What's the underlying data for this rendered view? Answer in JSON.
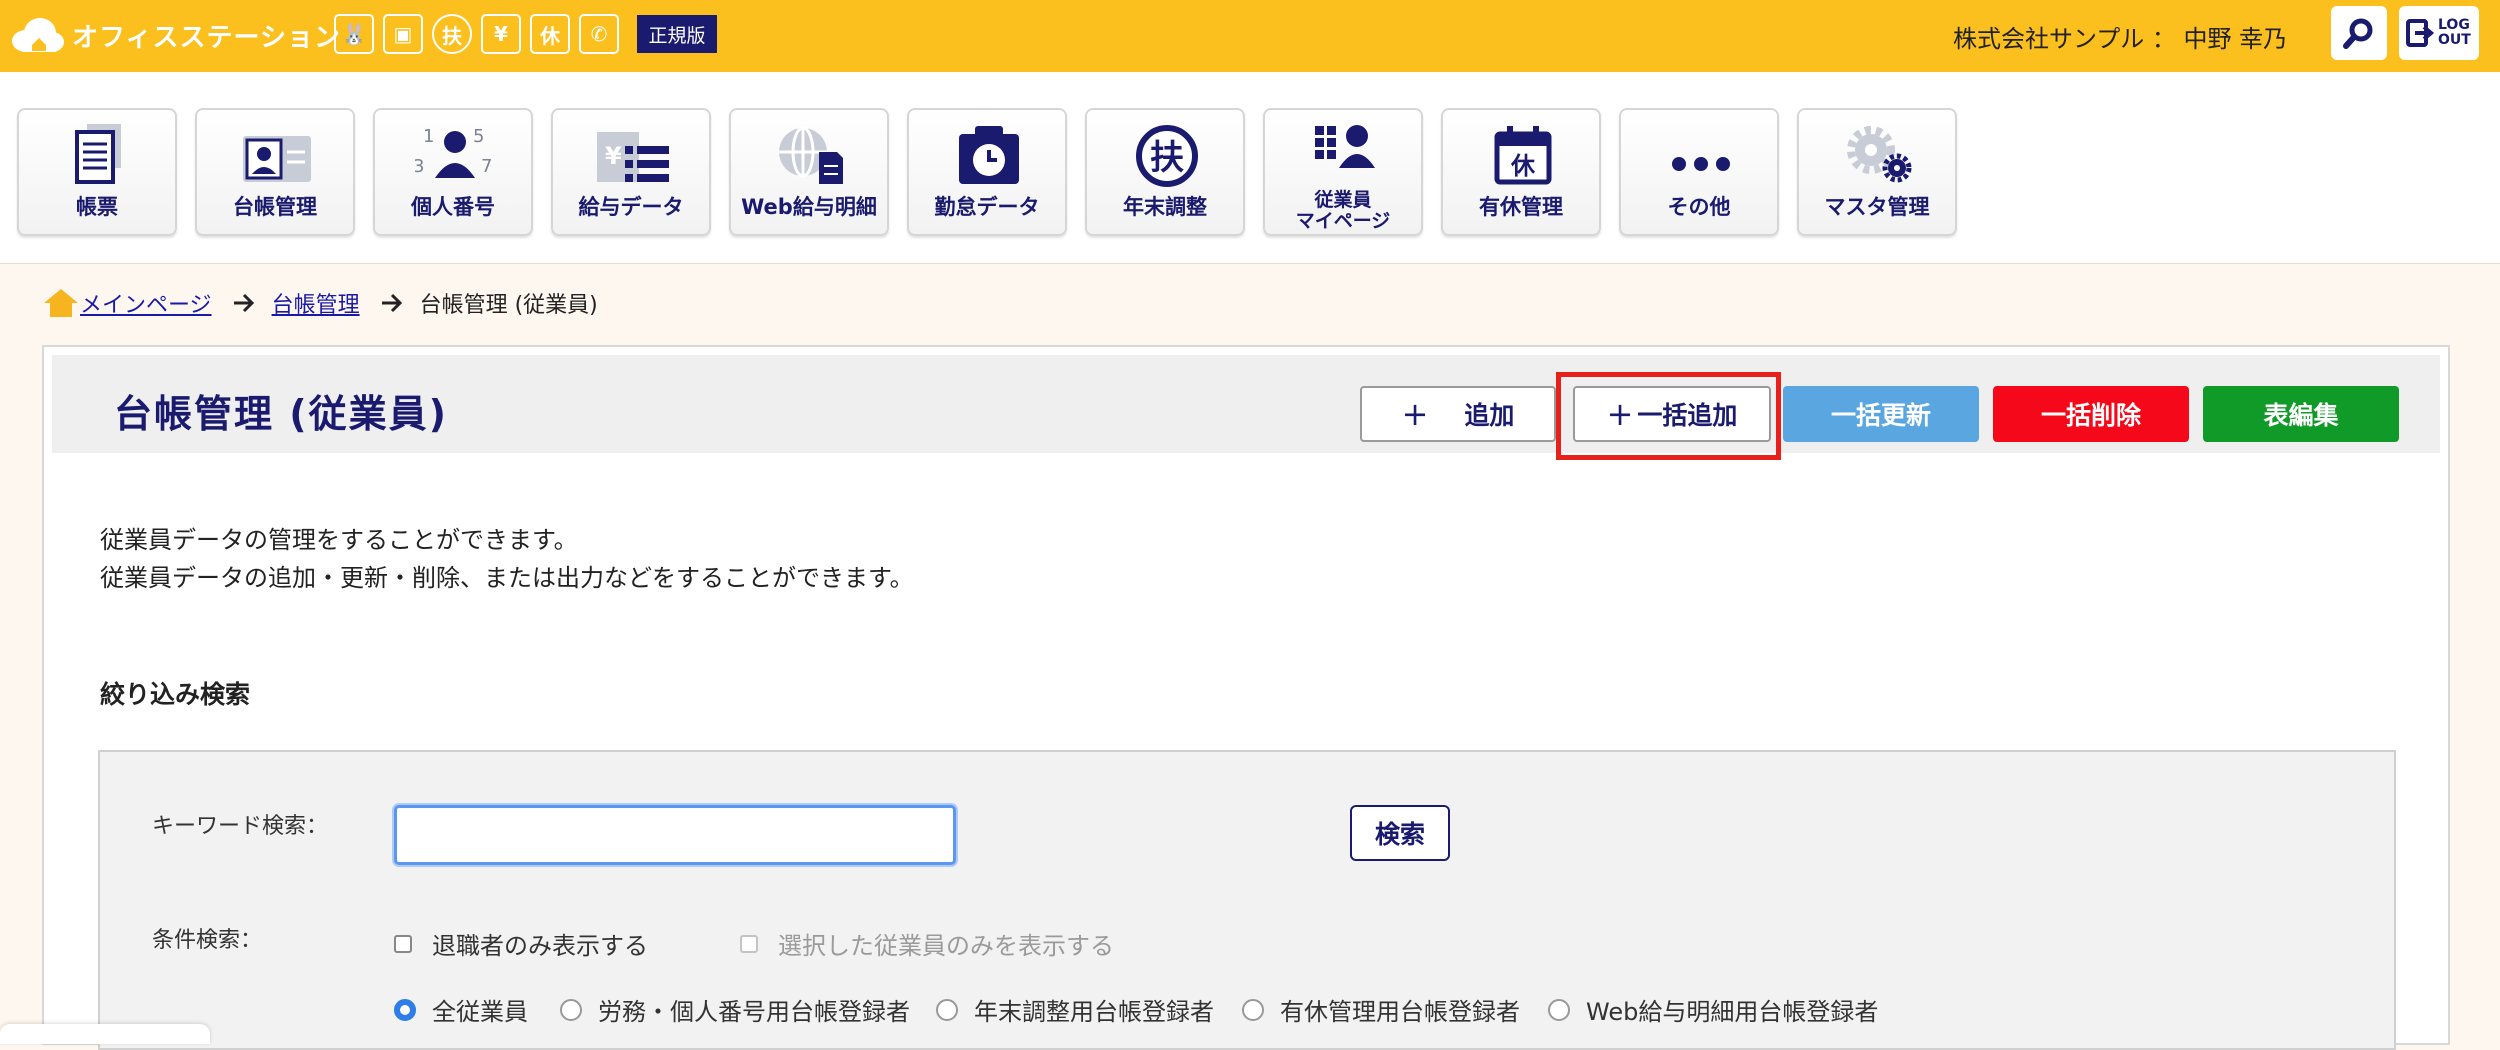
{
  "header": {
    "brand": "オフィスステーション",
    "edition": "正規版",
    "company_user": "株式会社サンプル ： 中野 幸乃",
    "logout_label": "LOG OUT",
    "mini_icons": [
      {
        "name": "rabbit-icon",
        "glyph": "🐰"
      },
      {
        "name": "briefcase-icon",
        "glyph": "▣"
      },
      {
        "name": "fu-icon",
        "glyph": "扶"
      },
      {
        "name": "payroll-icon",
        "glyph": "¥"
      },
      {
        "name": "kyu-icon",
        "glyph": "休"
      },
      {
        "name": "phone-icon",
        "glyph": "✆"
      }
    ],
    "colors": {
      "bar": "#fbbf1e",
      "navy": "#1a1a6e"
    }
  },
  "nav": {
    "tiles": [
      {
        "name": "nav-tile-forms",
        "label": "帳票",
        "icon": "document-icon"
      },
      {
        "name": "nav-tile-ledger",
        "label": "台帳管理",
        "icon": "id-card-icon"
      },
      {
        "name": "nav-tile-my-number",
        "label": "個人番号",
        "icon": "person-numbers-icon"
      },
      {
        "name": "nav-tile-payroll-data",
        "label": "給与データ",
        "icon": "payroll-icon"
      },
      {
        "name": "nav-tile-web-payslip",
        "label": "Web給与明細",
        "icon": "globe-doc-icon"
      },
      {
        "name": "nav-tile-attendance",
        "label": "勤怠データ",
        "icon": "clock-board-icon"
      },
      {
        "name": "nav-tile-year-end",
        "label": "年末調整",
        "icon": "fu-circle-icon"
      },
      {
        "name": "nav-tile-employee-mypage",
        "label": "従業員\nマイページ",
        "icon": "employee-grid-icon"
      },
      {
        "name": "nav-tile-paid-leave",
        "label": "有休管理",
        "icon": "calendar-kyu-icon"
      },
      {
        "name": "nav-tile-others",
        "label": "その他",
        "icon": "dots-icon"
      },
      {
        "name": "nav-tile-master",
        "label": "マスタ管理",
        "icon": "gears-icon"
      }
    ]
  },
  "breadcrumb": {
    "home": "メインページ",
    "ledger": "台帳管理",
    "current": "台帳管理 (従業員)"
  },
  "page": {
    "title": "台帳管理 (従業員)",
    "buttons": {
      "add": "追加",
      "bulk_add": "一括追加",
      "bulk_update": "一括更新",
      "bulk_delete": "一括削除",
      "table_edit": "表編集"
    },
    "description": [
      "従業員データの管理をすることができます。",
      "従業員データの追加・更新・削除、または出力などをすることができます。"
    ],
    "filter_title": "絞り込み検索"
  },
  "search": {
    "keyword_label": "キーワード検索：",
    "keyword_value": "",
    "search_button": "検索",
    "condition_label": "条件検索：",
    "checkboxes": [
      {
        "label": "退職者のみ表示する",
        "checked": false,
        "disabled": false
      },
      {
        "label": "選択した従業員のみを表示する",
        "checked": false,
        "disabled": true
      }
    ],
    "radios": [
      {
        "label": "全従業員",
        "selected": true
      },
      {
        "label": "労務・個人番号用台帳登録者",
        "selected": false
      },
      {
        "label": "年末調整用台帳登録者",
        "selected": false
      },
      {
        "label": "有休管理用台帳登録者",
        "selected": false
      },
      {
        "label": "Web給与明細用台帳登録者",
        "selected": false
      }
    ]
  }
}
